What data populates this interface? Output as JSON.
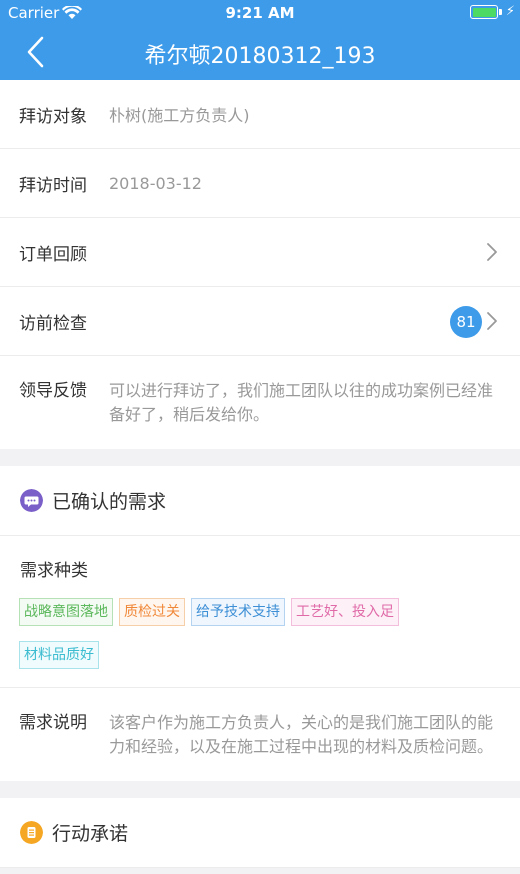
{
  "status_bar": {
    "carrier": "Carrier",
    "time": "9:21 AM",
    "battery_color": "#4cd964"
  },
  "nav": {
    "title": "希尔顿20180312_193",
    "back_icon": "chevron-left-icon"
  },
  "visit": {
    "target_label": "拜访对象",
    "target_value": "朴树(施工方负责人)",
    "time_label": "拜访时间",
    "time_value": "2018-03-12",
    "order_review_label": "订单回顾",
    "precheck_label": "访前检查",
    "precheck_badge": "81",
    "feedback_label": "领导反馈",
    "feedback_value": "可以进行拜访了，我们施工团队以往的成功案例已经准备好了，稍后发给你。"
  },
  "requirements": {
    "section_title": "已确认的需求",
    "section_icon": "chat-bubble-icon",
    "kind_label": "需求种类",
    "tags": [
      {
        "text": "战略意图落地",
        "color": "green"
      },
      {
        "text": "质检过关",
        "color": "orange"
      },
      {
        "text": "给予技术支持",
        "color": "blue"
      },
      {
        "text": "工艺好、投入足",
        "color": "pink"
      },
      {
        "text": "材料品质好",
        "color": "cyan"
      }
    ],
    "desc_label": "需求说明",
    "desc_value": "该客户作为施工方负责人，关心的是我们施工团队的能力和经验，以及在施工过程中出现的材料及质检问题。"
  },
  "actions": {
    "section_title": "行动承诺",
    "section_icon": "list-icon"
  },
  "colors": {
    "accent": "#3d9be9",
    "requirements_icon": "#7b5fc9",
    "actions_icon": "#f5a623"
  }
}
